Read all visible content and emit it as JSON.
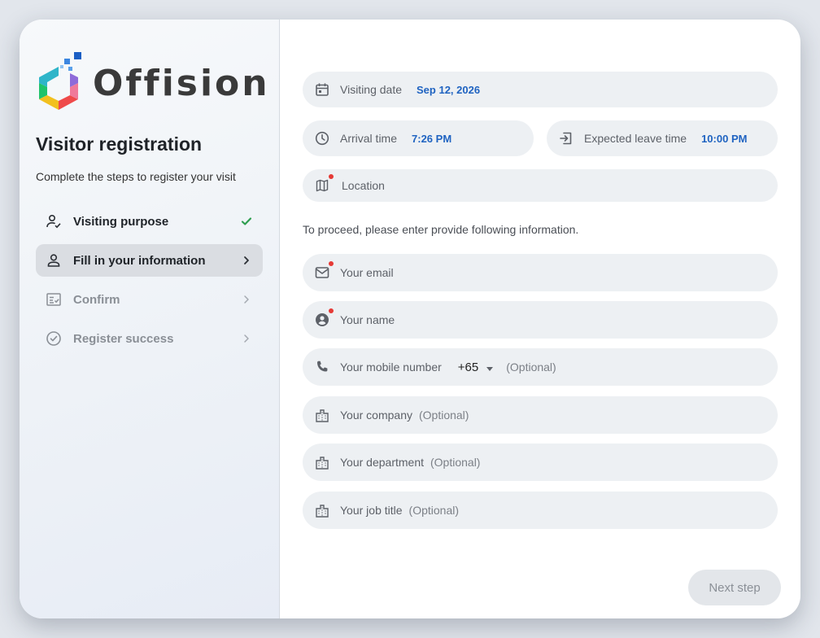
{
  "brand": {
    "name": "Offision"
  },
  "left": {
    "title": "Visitor registration",
    "subtitle": "Complete the steps to register your visit",
    "steps": [
      {
        "label": "Visiting purpose",
        "state": "done",
        "icon": "person-check-icon",
        "end_icon": "check-icon"
      },
      {
        "label": "Fill in your information",
        "state": "active",
        "icon": "person-icon",
        "end_icon": "chevron-right-icon"
      },
      {
        "label": "Confirm",
        "state": "pending",
        "icon": "form-check-icon",
        "end_icon": "chevron-right-icon"
      },
      {
        "label": "Register success",
        "state": "pending",
        "icon": "circle-check-icon",
        "end_icon": "chevron-right-icon"
      }
    ]
  },
  "form": {
    "visiting_date": {
      "label": "Visiting date",
      "value": "Sep 12, 2026"
    },
    "arrival_time": {
      "label": "Arrival time",
      "value": "7:26 PM"
    },
    "leave_time": {
      "label": "Expected leave time",
      "value": "10:00 PM"
    },
    "location": {
      "label": "Location"
    },
    "hint": "To proceed, please enter provide following information.",
    "email": {
      "placeholder": "Your email"
    },
    "name": {
      "placeholder": "Your name"
    },
    "mobile": {
      "label": "Your mobile number",
      "country_code": "+65",
      "optional": "(Optional)"
    },
    "company": {
      "label": "Your company",
      "optional": "(Optional)"
    },
    "department": {
      "label": "Your department",
      "optional": "(Optional)"
    },
    "job_title": {
      "label": "Your job title",
      "optional": "(Optional)"
    },
    "next_label": "Next step"
  },
  "colors": {
    "accent_value": "#1f63c1",
    "check_green": "#2e9e4f",
    "required_dot": "#e53935",
    "field_bg": "#edf0f3"
  }
}
